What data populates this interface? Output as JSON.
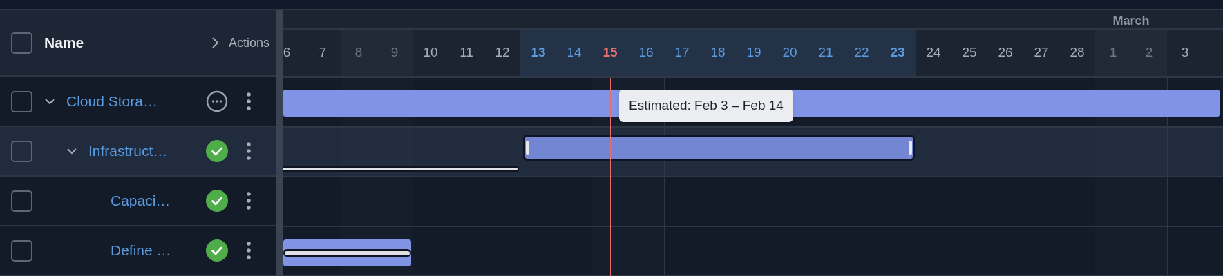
{
  "header": {
    "select_all": {
      "checked": false
    },
    "name_label": "Name",
    "actions_label": "Actions"
  },
  "days": [
    {
      "label": "6",
      "kind": "weekday"
    },
    {
      "label": "7",
      "kind": "weekday"
    },
    {
      "label": "8",
      "kind": "weekend"
    },
    {
      "label": "9",
      "kind": "weekend"
    },
    {
      "label": "10",
      "kind": "weekday"
    },
    {
      "label": "11",
      "kind": "weekday"
    },
    {
      "label": "12",
      "kind": "weekday"
    },
    {
      "label": "13",
      "kind": "range-edge"
    },
    {
      "label": "14",
      "kind": "range"
    },
    {
      "label": "15",
      "kind": "today"
    },
    {
      "label": "16",
      "kind": "range"
    },
    {
      "label": "17",
      "kind": "range"
    },
    {
      "label": "18",
      "kind": "range"
    },
    {
      "label": "19",
      "kind": "range"
    },
    {
      "label": "20",
      "kind": "range"
    },
    {
      "label": "21",
      "kind": "range"
    },
    {
      "label": "22",
      "kind": "range"
    },
    {
      "label": "23",
      "kind": "range-edge"
    },
    {
      "label": "24",
      "kind": "weekday"
    },
    {
      "label": "25",
      "kind": "weekday"
    },
    {
      "label": "26",
      "kind": "weekday"
    },
    {
      "label": "27",
      "kind": "weekday"
    },
    {
      "label": "28",
      "kind": "weekday"
    },
    {
      "label": "1",
      "kind": "weekend",
      "month": "March"
    },
    {
      "label": "2",
      "kind": "weekend"
    },
    {
      "label": "3",
      "kind": "weekday"
    }
  ],
  "tasks": [
    {
      "name": "Cloud Stora…",
      "checked": false,
      "expanded": true,
      "selected": false,
      "done": false,
      "tooltip": "Estimated: Feb 3 – Feb 14",
      "children": [
        {
          "name": "Infrastruct…",
          "checked": false,
          "expanded": true,
          "selected": true,
          "done": true,
          "children": [
            {
              "name": "Capaci…",
              "checked": false,
              "selected": false,
              "done": true
            },
            {
              "name": "Define …",
              "checked": false,
              "selected": false,
              "done": true
            }
          ]
        }
      ]
    }
  ]
}
